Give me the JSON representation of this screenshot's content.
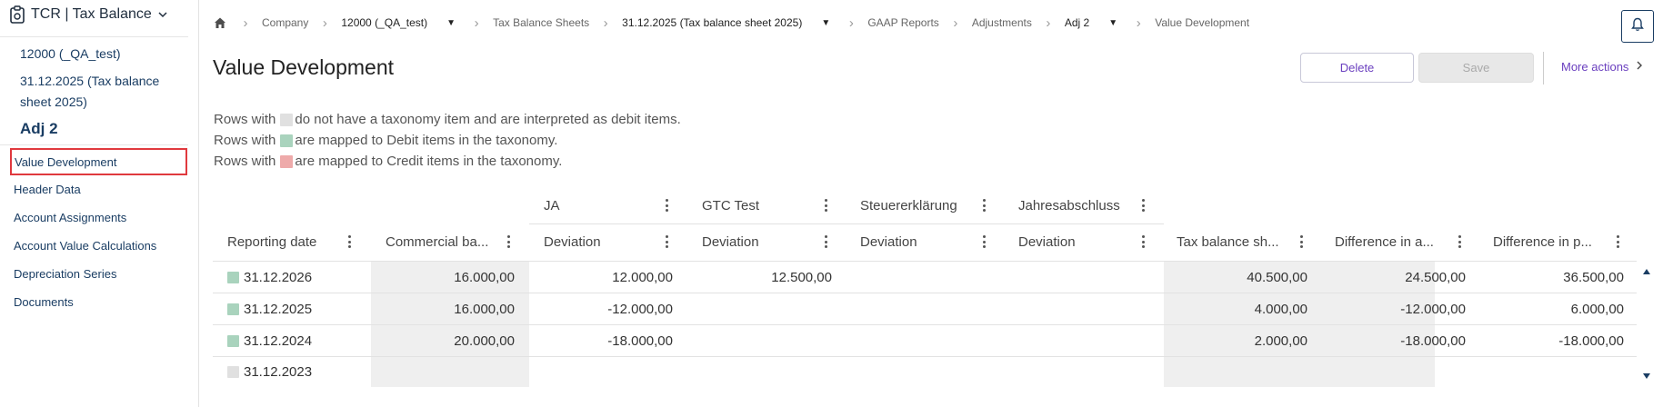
{
  "app": {
    "title": "TCR | Tax Balance"
  },
  "sidebar": {
    "context": {
      "company": "12000 (_QA_test)",
      "sheet_line1": "31.12.2025 (Tax balance",
      "sheet_line2": "sheet 2025)",
      "adjustment": "Adj 2"
    },
    "nav": [
      {
        "label": "Value Development",
        "active": true
      },
      {
        "label": "Header Data"
      },
      {
        "label": "Account Assignments"
      },
      {
        "label": "Account Value Calculations"
      },
      {
        "label": "Depreciation Series"
      },
      {
        "label": "Documents"
      }
    ]
  },
  "breadcrumb": {
    "items": [
      "Company",
      "12000 (_QA_test)",
      "31.12.2025 (Tax balance sheet 2025)",
      "GAAP Reports",
      "Adjustments",
      "Adj 2",
      "Value Development"
    ]
  },
  "header": {
    "title": "Value Development",
    "delete_label": "Delete",
    "save_label": "Save",
    "more_actions_label": "More actions"
  },
  "legend": {
    "row1_prefix": "Rows with",
    "row1_suffix": "do not have a taxonomy item and are interpreted as debit items.",
    "row2_prefix": "Rows with",
    "row2_suffix": "are mapped to Debit items in the taxonomy.",
    "row3_prefix": "Rows with",
    "row3_suffix": "are mapped to Credit items in the taxonomy.",
    "colors": {
      "none": "#e0e0e0",
      "debit": "#a9d3bd",
      "credit": "#eeaaaa"
    }
  },
  "grid": {
    "group_headers": [
      "JA",
      "GTC Test",
      "Steuererklärung",
      "Jahresabschluss"
    ],
    "columns": [
      "Reporting date",
      "Commercial ba...",
      "Deviation",
      "Deviation",
      "Deviation",
      "Deviation",
      "Tax balance sh...",
      "Difference in a...",
      "Difference in p..."
    ],
    "rows": [
      {
        "type": "debit",
        "date": "31.12.2026",
        "commercial": "16.000,00",
        "dev_ja": "12.000,00",
        "dev_gtc": "12.500,00",
        "dev_st": "",
        "dev_jab": "",
        "tax": "40.500,00",
        "diff_a": "24.500,00",
        "diff_p": "36.500,00"
      },
      {
        "type": "debit",
        "date": "31.12.2025",
        "commercial": "16.000,00",
        "dev_ja": "-12.000,00",
        "dev_gtc": "",
        "dev_st": "",
        "dev_jab": "",
        "tax": "4.000,00",
        "diff_a": "-12.000,00",
        "diff_p": "6.000,00"
      },
      {
        "type": "debit",
        "date": "31.12.2024",
        "commercial": "20.000,00",
        "dev_ja": "-18.000,00",
        "dev_gtc": "",
        "dev_st": "",
        "dev_jab": "",
        "tax": "2.000,00",
        "diff_a": "-18.000,00",
        "diff_p": "-18.000,00"
      },
      {
        "type": "none",
        "date": "31.12.2023",
        "commercial": "",
        "dev_ja": "",
        "dev_gtc": "",
        "dev_st": "",
        "dev_jab": "",
        "tax": "",
        "diff_a": "",
        "diff_p": ""
      }
    ]
  },
  "icons": {
    "app": "clipboard-icon",
    "home": "home-icon",
    "bell": "bell-icon"
  }
}
